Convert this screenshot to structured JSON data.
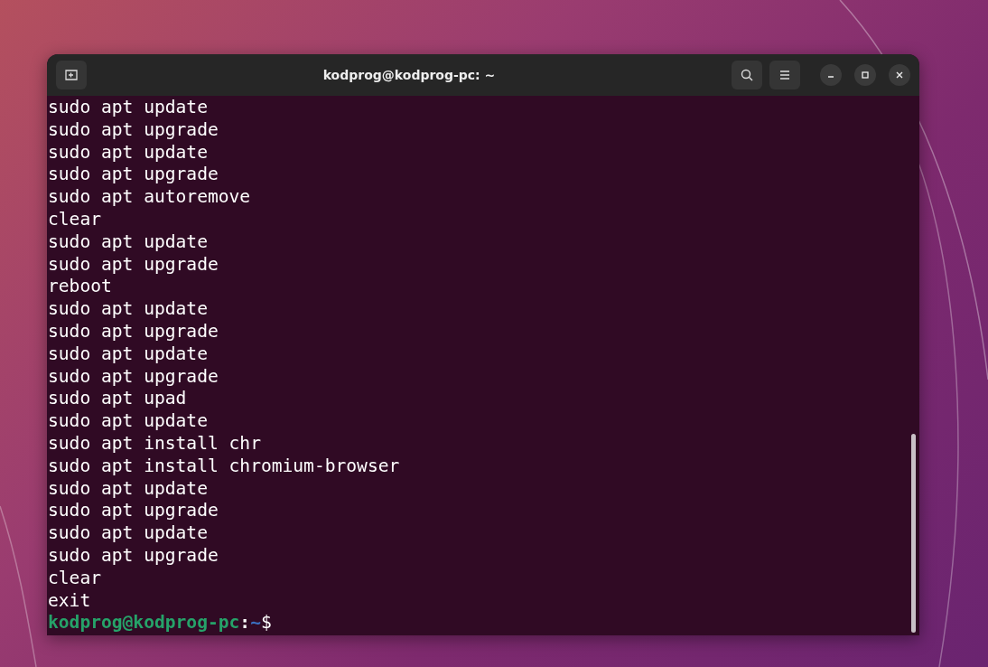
{
  "window": {
    "title": "kodprog@kodprog-pc: ~"
  },
  "terminal": {
    "lines": [
      "sudo apt update",
      "sudo apt upgrade",
      "sudo apt update",
      "sudo apt upgrade",
      "sudo apt autoremove",
      "clear",
      "sudo apt update",
      "sudo apt upgrade",
      "reboot",
      "sudo apt update",
      "sudo apt upgrade",
      "sudo apt update",
      "sudo apt upgrade",
      "sudo apt upad",
      "sudo apt update",
      "sudo apt install chr",
      "sudo apt install chromium-browser",
      "sudo apt update",
      "sudo apt upgrade",
      "sudo apt update",
      "sudo apt upgrade",
      "clear",
      "exit"
    ],
    "prompt": {
      "user_host": "kodprog@kodprog-pc",
      "separator": ":",
      "path": "~",
      "symbol": "$"
    }
  }
}
